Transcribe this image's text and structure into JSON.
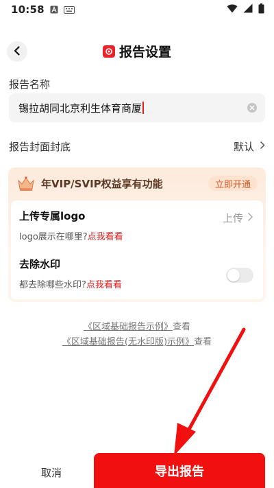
{
  "status_bar": {
    "time": "10:58",
    "icons": [
      "a-badge-icon",
      "keyboard-icon",
      "wifi-icon",
      "signal-icon",
      "battery-icon"
    ]
  },
  "header": {
    "title": "报告设置",
    "back_icon": "chevron-left-icon",
    "brand_icon": "brand-logo-icon"
  },
  "report_name": {
    "label": "报告名称",
    "value": "锡拉胡同北京利生体育商厦"
  },
  "cover": {
    "label": "报告封面封底",
    "value": "默认"
  },
  "vip": {
    "title": "年VIP/SVIP权益享有功能",
    "open_label": "立即开通",
    "upload_logo": {
      "title": "上传专属logo",
      "hint": "logo展示在哪里?",
      "link": "点我看看",
      "action": "上传"
    },
    "remove_watermark": {
      "title": "去除水印",
      "hint": "都去除哪些水印?",
      "link": "点我看看",
      "enabled": false
    }
  },
  "samples": {
    "sample1_link": "《区域基础报告示例》",
    "sample1_action": "查看",
    "sample2_link": "《区域基础报告(无水印版)示例》",
    "sample2_action": "查看"
  },
  "footer": {
    "cancel_label": "取消",
    "export_label": "导出报告"
  },
  "colors": {
    "accent": "#f01010",
    "link_red": "#e21b1b",
    "vip_text": "#5b3a25",
    "vip_button_text": "#d65a2a"
  }
}
